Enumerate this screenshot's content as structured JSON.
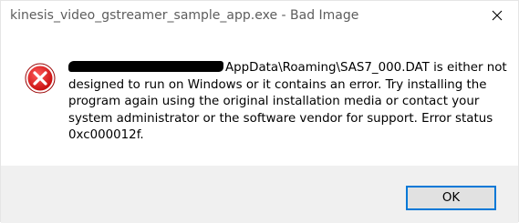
{
  "window": {
    "title": "kinesis_video_gstreamer_sample_app.exe - Bad Image",
    "close_icon": "close-icon"
  },
  "dialog": {
    "icon": "error-icon",
    "message_tail_line1": "AppData\\Roaming\\SAS7_000.DAT is either",
    "message_rest": "not designed to run on Windows or it contains an error. Try installing the program again using the original installation media or contact your system administrator or the software vendor for support. Error status 0xc000012f."
  },
  "buttons": {
    "ok_label": "OK"
  },
  "colors": {
    "error_red": "#e81123",
    "accent_blue": "#0078d7",
    "footer_bg": "#f0f0f0"
  }
}
